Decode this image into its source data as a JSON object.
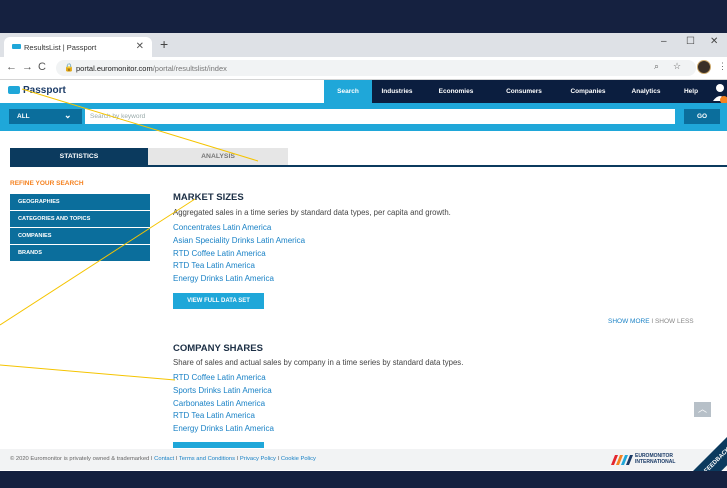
{
  "browser": {
    "tab_title": "ResultsList | Passport",
    "tab_close": "✕",
    "new_tab": "+",
    "url_host": "portal.euromonitor.com",
    "url_path": "/portal/resultslist/index",
    "win_minimize": "–",
    "win_maximize": "☐",
    "win_close": "✕"
  },
  "header": {
    "logo": "Passport",
    "nav": [
      {
        "label": "Search",
        "active": true
      },
      {
        "label": "Industries"
      },
      {
        "label": "Economies"
      },
      {
        "label": "Consumers"
      },
      {
        "label": "Companies"
      },
      {
        "label": "Analytics"
      },
      {
        "label": "Help"
      }
    ]
  },
  "search": {
    "scope": "ALL",
    "placeholder": "Search by keyword",
    "go_label": "GO"
  },
  "tabs": {
    "statistics": "STATISTICS",
    "analysis": "ANALYSIS"
  },
  "sidebar": {
    "heading": "REFINE YOUR SEARCH",
    "items": [
      "GEOGRAPHIES",
      "CATEGORIES AND TOPICS",
      "COMPANIES",
      "BRANDS"
    ]
  },
  "market_sizes": {
    "title": "MARKET SIZES",
    "description": "Aggregated sales in a time series by standard data types, per capita and growth.",
    "links": [
      "Concentrates Latin America",
      "Asian Speciality Drinks Latin America",
      "RTD Coffee Latin America",
      "RTD Tea Latin America",
      "Energy Drinks Latin America"
    ],
    "button": "VIEW FULL DATA SET",
    "show_more": "SHOW MORE",
    "show_less": "SHOW LESS",
    "separator": "I"
  },
  "company_shares": {
    "title": "COMPANY SHARES",
    "description": "Share of sales and actual sales by company in a time series by standard data types.",
    "links": [
      "RTD Coffee Latin America",
      "Sports Drinks Latin America",
      "Carbonates Latin America",
      "RTD Tea Latin America",
      "Energy Drinks Latin America"
    ]
  },
  "footer": {
    "copyright": "© 2020 Euromonitor is privately owned & trademarked",
    "sep": "I",
    "links": [
      "Contact",
      "Terms and Conditions",
      "Privacy Policy",
      "Cookie Policy"
    ],
    "logo_line1": "EUROMONITOR",
    "logo_line2": "INTERNATIONAL",
    "feedback": "FEEDBACK"
  },
  "colors": {
    "page_bg": "#152140",
    "nav_bg": "#0b1e3f",
    "accent": "#1fa7d9",
    "dark_blue": "#0b3a5e",
    "orange": "#f58220",
    "annotation_line": "#f5c400"
  }
}
